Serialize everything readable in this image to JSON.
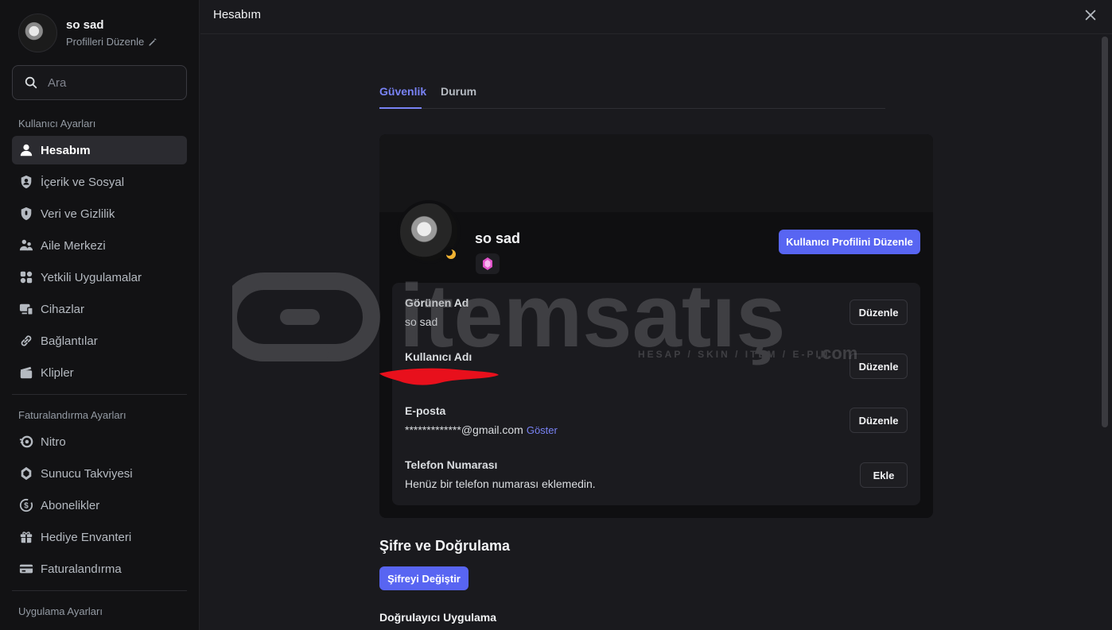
{
  "profile": {
    "name": "so sad",
    "edit_label": "Profilleri Düzenle"
  },
  "search": {
    "placeholder": "Ara"
  },
  "sidebar": {
    "user_settings_title": "Kullanıcı Ayarları",
    "user_items": [
      {
        "label": "Hesabım",
        "icon": "user-icon",
        "active": true
      },
      {
        "label": "İçerik ve Sosyal",
        "icon": "shield-user-icon"
      },
      {
        "label": "Veri ve Gizlilik",
        "icon": "shield-icon"
      },
      {
        "label": "Aile Merkezi",
        "icon": "family-icon"
      },
      {
        "label": "Yetkili Uygulamalar",
        "icon": "apps-icon"
      },
      {
        "label": "Cihazlar",
        "icon": "devices-icon"
      },
      {
        "label": "Bağlantılar",
        "icon": "link-icon"
      },
      {
        "label": "Klipler",
        "icon": "clapper-icon"
      }
    ],
    "billing_title": "Faturalandırma Ayarları",
    "billing_items": [
      {
        "label": "Nitro",
        "icon": "nitro-icon"
      },
      {
        "label": "Sunucu Takviyesi",
        "icon": "boost-icon"
      },
      {
        "label": "Abonelikler",
        "icon": "subscription-icon"
      },
      {
        "label": "Hediye Envanteri",
        "icon": "gift-icon"
      },
      {
        "label": "Faturalandırma",
        "icon": "card-icon"
      }
    ],
    "app_settings_title": "Uygulama Ayarları"
  },
  "header": {
    "title": "Hesabım"
  },
  "tabs": [
    {
      "label": "Güvenlik",
      "active": true
    },
    {
      "label": "Durum",
      "active": false
    }
  ],
  "account_card": {
    "display_name": "so sad",
    "edit_profile_label": "Kullanıcı Profilini Düzenle",
    "fields": {
      "display_name": {
        "label": "Görünen Ad",
        "value": "so sad",
        "button": "Düzenle"
      },
      "username": {
        "label": "Kullanıcı Adı",
        "value": "",
        "button": "Düzenle"
      },
      "email": {
        "label": "E-posta",
        "value": "*************@gmail.com",
        "reveal": "Göster",
        "button": "Düzenle"
      },
      "phone": {
        "label": "Telefon Numarası",
        "value": "Henüz bir telefon numarası eklemedin.",
        "button": "Ekle"
      }
    }
  },
  "password_section": {
    "title": "Şifre ve Doğrulama",
    "change_label": "Şifreyi Değiştir",
    "authenticator_title": "Doğrulayıcı Uygulama"
  },
  "watermark": {
    "brand": "itemsatış",
    "tagline": "HESAP / SKIN / ITEM / E-PIN",
    "suffix": ".com"
  },
  "colors": {
    "accent": "#5865f2",
    "link": "#7983f5",
    "background": "#1a1a1e",
    "sidebar": "#121214"
  }
}
